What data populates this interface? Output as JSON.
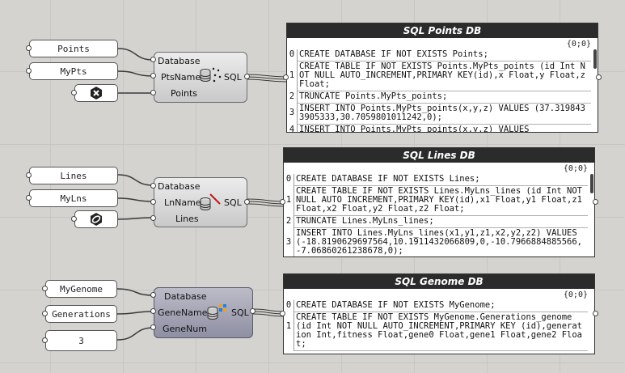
{
  "canvas": {
    "grid": true
  },
  "groups": [
    {
      "id": "points",
      "inputs": [
        "Points",
        "MyPts"
      ],
      "component": {
        "ports": [
          "Database",
          "PtsName",
          "Points"
        ],
        "output": "SQL"
      },
      "panel": {
        "title": "SQL Points DB",
        "path": "{0;0}",
        "items": [
          {
            "index": "0",
            "text": "CREATE DATABASE IF NOT EXISTS Points;"
          },
          {
            "index": "1",
            "text": "CREATE TABLE IF NOT EXISTS Points.MyPts_points (id Int NOT NULL AUTO_INCREMENT,PRIMARY KEY(id),x Float,y Float,z Float;"
          },
          {
            "index": "2",
            "text": "TRUNCATE Points.MyPts_points;"
          },
          {
            "index": "3",
            "text": "INSERT INTO Points.MyPts_points(x,y,z) VALUES (37.3198433905333,30.7059801011242,0);"
          },
          {
            "index": "4",
            "text": "INSERT INTO Points.MyPts_points(x,y,z) VALUES"
          }
        ]
      }
    },
    {
      "id": "lines",
      "inputs": [
        "Lines",
        "MyLns"
      ],
      "component": {
        "ports": [
          "Database",
          "LnName",
          "Lines"
        ],
        "output": "SQL"
      },
      "panel": {
        "title": "SQL Lines DB",
        "path": "{0;0}",
        "items": [
          {
            "index": "0",
            "text": "CREATE DATABASE IF NOT EXISTS Lines;"
          },
          {
            "index": "1",
            "text": "CREATE TABLE IF NOT EXISTS Lines.MyLns_lines (id Int NOT NULL AUTO_INCREMENT,PRIMARY KEY(id),x1 Float,y1 Float,z1 Float,x2 Float,y2 Float,z2 Float;"
          },
          {
            "index": "2",
            "text": "TRUNCATE Lines.MyLns_lines;"
          },
          {
            "index": "3",
            "text": "INSERT INTO Lines.MyLns_lines(x1,y1,z1,x2,y2,z2) VALUES (-18.8190629697564,10.1911432066809,0,-10.7966884885566,-7.06860261238678,0);"
          }
        ]
      }
    },
    {
      "id": "genome",
      "inputs": [
        "MyGenome",
        "Generations",
        "3"
      ],
      "component": {
        "ports": [
          "Database",
          "GeneName",
          "GeneNum"
        ],
        "output": "SQL"
      },
      "panel": {
        "title": "SQL Genome DB",
        "path": "{0;0}",
        "items": [
          {
            "index": "0",
            "text": "CREATE DATABASE IF NOT EXISTS MyGenome;"
          },
          {
            "index": "1",
            "text": "CREATE TABLE IF NOT EXISTS MyGenome.Generations_genome (id Int NOT NULL AUTO_INCREMENT,PRIMARY KEY (id),generation Int,fitness Float,gene0 Float,gene1 Float,gene2 Float;"
          }
        ]
      }
    }
  ]
}
